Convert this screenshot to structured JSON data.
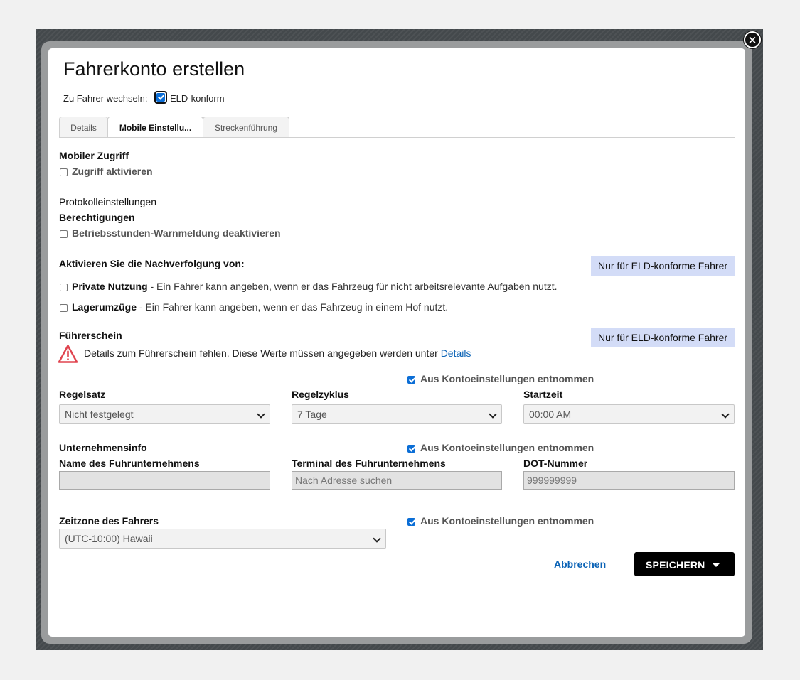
{
  "dialog": {
    "title": "Fahrerkonto erstellen",
    "switch_label": "Zu Fahrer wechseln:",
    "eld_label": "ELD-konform",
    "close_icon": "close-icon"
  },
  "tabs": [
    {
      "label": "Details",
      "active": false
    },
    {
      "label": "Mobile Einstellu...",
      "active": true
    },
    {
      "label": "Streckenführung",
      "active": false
    }
  ],
  "mobile": {
    "heading": "Mobiler Zugriff",
    "access_label": "Zugriff aktivieren"
  },
  "protocol": {
    "heading": "Protokolleinstellungen",
    "permissions": "Berechtigungen",
    "hours_warning_label": "Betriebsstunden-Warnmeldung deaktivieren"
  },
  "tracking": {
    "heading": "Aktivieren Sie die Nachverfolgung von:",
    "badge": "Nur für ELD-konforme Fahrer",
    "private_title": "Private Nutzung",
    "private_desc": " - Ein Fahrer kann angeben, wenn er das Fahrzeug für nicht arbeitsrelevante Aufgaben nutzt.",
    "yard_title": "Lagerumzüge",
    "yard_desc": " - Ein Fahrer kann angeben, wenn er das Fahrzeug in einem Hof nutzt."
  },
  "license": {
    "heading": "Führerschein",
    "badge": "Nur für ELD-konforme Fahrer",
    "warning_text": "Details zum Führerschein fehlen. Diese Werte müssen angegeben werden unter ",
    "warning_link": "Details"
  },
  "rules": {
    "from_account": "Aus Kontoeinstellungen entnommen",
    "ruleset_label": "Regelsatz",
    "ruleset_value": "Nicht festgelegt",
    "cycle_label": "Regelzyklus",
    "cycle_value": "7 Tage",
    "start_label": "Startzeit",
    "start_value": "00:00 AM"
  },
  "company": {
    "heading": "Unternehmensinfo",
    "from_account": "Aus Kontoeinstellungen entnommen",
    "name_label": "Name des Fuhrunternehmens",
    "name_value": "",
    "terminal_label": "Terminal des Fuhrunternehmens",
    "terminal_placeholder": "Nach Adresse suchen",
    "dot_label": "DOT-Nummer",
    "dot_value": "999999999"
  },
  "timezone": {
    "label": "Zeitzone des Fahrers",
    "from_account": "Aus Kontoeinstellungen entnommen",
    "value": "(UTC-10:00) Hawaii"
  },
  "actions": {
    "cancel": "Abbrechen",
    "save": "SPEICHERN"
  },
  "colors": {
    "accent": "#0b6ed6",
    "link": "#0b63b6",
    "badge_bg": "#d3dcf7",
    "warning": "#e0444f"
  }
}
